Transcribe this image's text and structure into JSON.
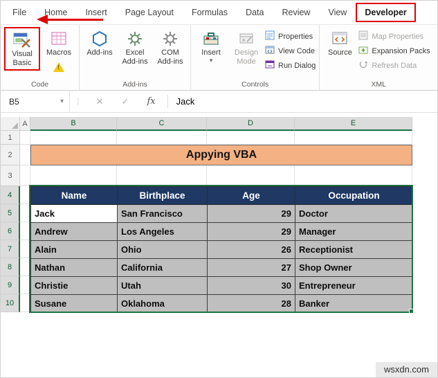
{
  "window": {
    "watermark": "wsxdn.com"
  },
  "tabbar": {
    "tabs": [
      "File",
      "Home",
      "Insert",
      "Page Layout",
      "Formulas",
      "Data",
      "Review",
      "View",
      "Developer"
    ],
    "active_tab": "Developer"
  },
  "ribbon": {
    "code_group": {
      "label": "Code",
      "visual_basic": "Visual Basic",
      "macros": "Macros"
    },
    "addins_group": {
      "label": "Add-ins",
      "add_ins": "Add-ins",
      "excel_add_ins": "Excel Add-ins",
      "com_add_ins": "COM Add-ins"
    },
    "controls_group": {
      "label": "Controls",
      "insert": "Insert",
      "design_mode": "Design Mode",
      "properties": "Properties",
      "view_code": "View Code",
      "run_dialog": "Run Dialog"
    },
    "xml_group": {
      "label": "XML",
      "source": "Source",
      "map_properties": "Map Properties",
      "expansion_packs": "Expansion Packs",
      "refresh_data": "Refresh Data"
    }
  },
  "formula_bar": {
    "name_box": "B5",
    "value": "Jack"
  },
  "icons": {
    "dropdown": "▾",
    "cancel": "✕",
    "enter": "✓",
    "function": "fx",
    "warning": "!",
    "separator_dots": "⁞"
  },
  "sheet": {
    "column_headers": [
      "A",
      "B",
      "C",
      "D",
      "E"
    ],
    "row_headers": [
      "1",
      "2",
      "3",
      "4",
      "5",
      "6",
      "7",
      "8",
      "9",
      "10"
    ],
    "title": "Appying VBA",
    "active_cell": "B5",
    "table": {
      "headers": [
        "Name",
        "Birthplace",
        "Age",
        "Occupation"
      ],
      "rows": [
        [
          "Jack",
          "San Francisco",
          "29",
          "Doctor"
        ],
        [
          "Andrew",
          "Los Angeles",
          "29",
          "Manager"
        ],
        [
          "Alain",
          "Ohio",
          "26",
          "Receptionist"
        ],
        [
          "Nathan",
          "California",
          "27",
          "Shop Owner"
        ],
        [
          "Christie",
          "Utah",
          "30",
          "Entrepreneur"
        ],
        [
          "Susane",
          "Oklahoma",
          "28",
          "Banker"
        ]
      ]
    }
  },
  "colors": {
    "annotation_red": "#e00000",
    "excel_green": "#1e7145",
    "table_header_bg": "#1f3864",
    "table_row_bg": "#bfbfbf",
    "title_bg": "#f4b183"
  }
}
